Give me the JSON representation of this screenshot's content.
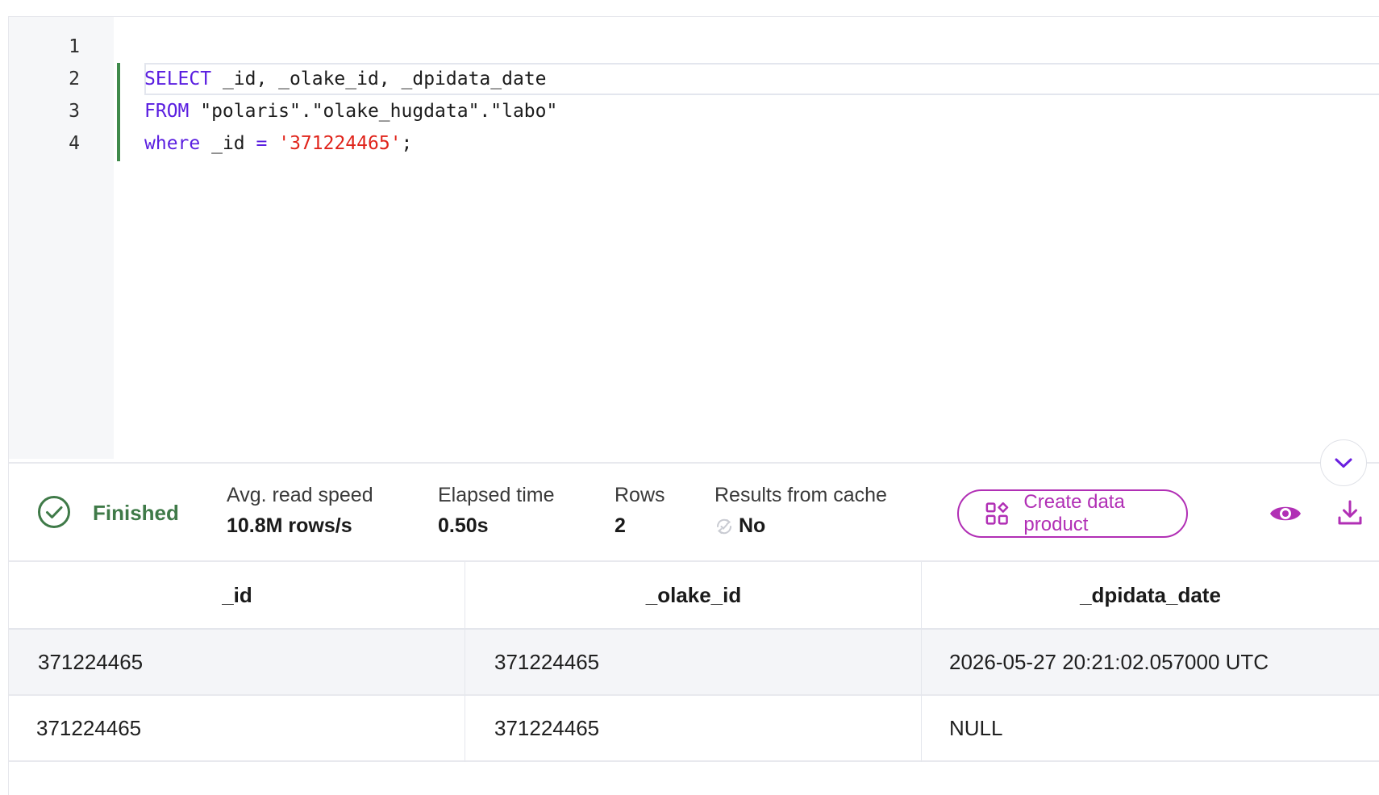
{
  "editor": {
    "line_numbers": [
      "1",
      "2",
      "3",
      "4"
    ],
    "lines": [
      [],
      [
        {
          "t": "SELECT",
          "c": "kw"
        },
        {
          "t": " _id, _olake_id, _dpidata_date",
          "c": ""
        }
      ],
      [
        {
          "t": "FROM",
          "c": "kw"
        },
        {
          "t": " \"polaris\".\"olake_hugdata\".\"labo\"",
          "c": ""
        }
      ],
      [
        {
          "t": "where",
          "c": "kw"
        },
        {
          "t": " _id ",
          "c": ""
        },
        {
          "t": "=",
          "c": "op"
        },
        {
          "t": " ",
          "c": ""
        },
        {
          "t": "'371224465'",
          "c": "str"
        },
        {
          "t": ";",
          "c": ""
        }
      ]
    ]
  },
  "status": {
    "state": "Finished",
    "avg_read_speed_label": "Avg. read speed",
    "avg_read_speed_value": "10.8M rows/s",
    "elapsed_label": "Elapsed time",
    "elapsed_value": "0.50s",
    "rows_label": "Rows",
    "rows_value": "2",
    "cache_label": "Results from cache",
    "cache_value": "No",
    "create_button_label": "Create data product",
    "icons": [
      "check-circle-icon",
      "cache-icon",
      "grid-add-icon",
      "eye-icon",
      "download-icon",
      "chevron-down-icon"
    ],
    "colors": {
      "success": "#3f7a48",
      "accent": "#b12fb5",
      "keyword": "#5a1ee0",
      "string": "#e0241b",
      "collapse_chevron": "#6a1fe0"
    }
  },
  "table": {
    "columns": [
      "_id",
      "_olake_id",
      "_dpidata_date"
    ],
    "rows": [
      [
        "371224465",
        "371224465",
        "2026-05-27 20:21:02.057000 UTC"
      ],
      [
        "371224465",
        "371224465",
        "NULL"
      ]
    ]
  }
}
